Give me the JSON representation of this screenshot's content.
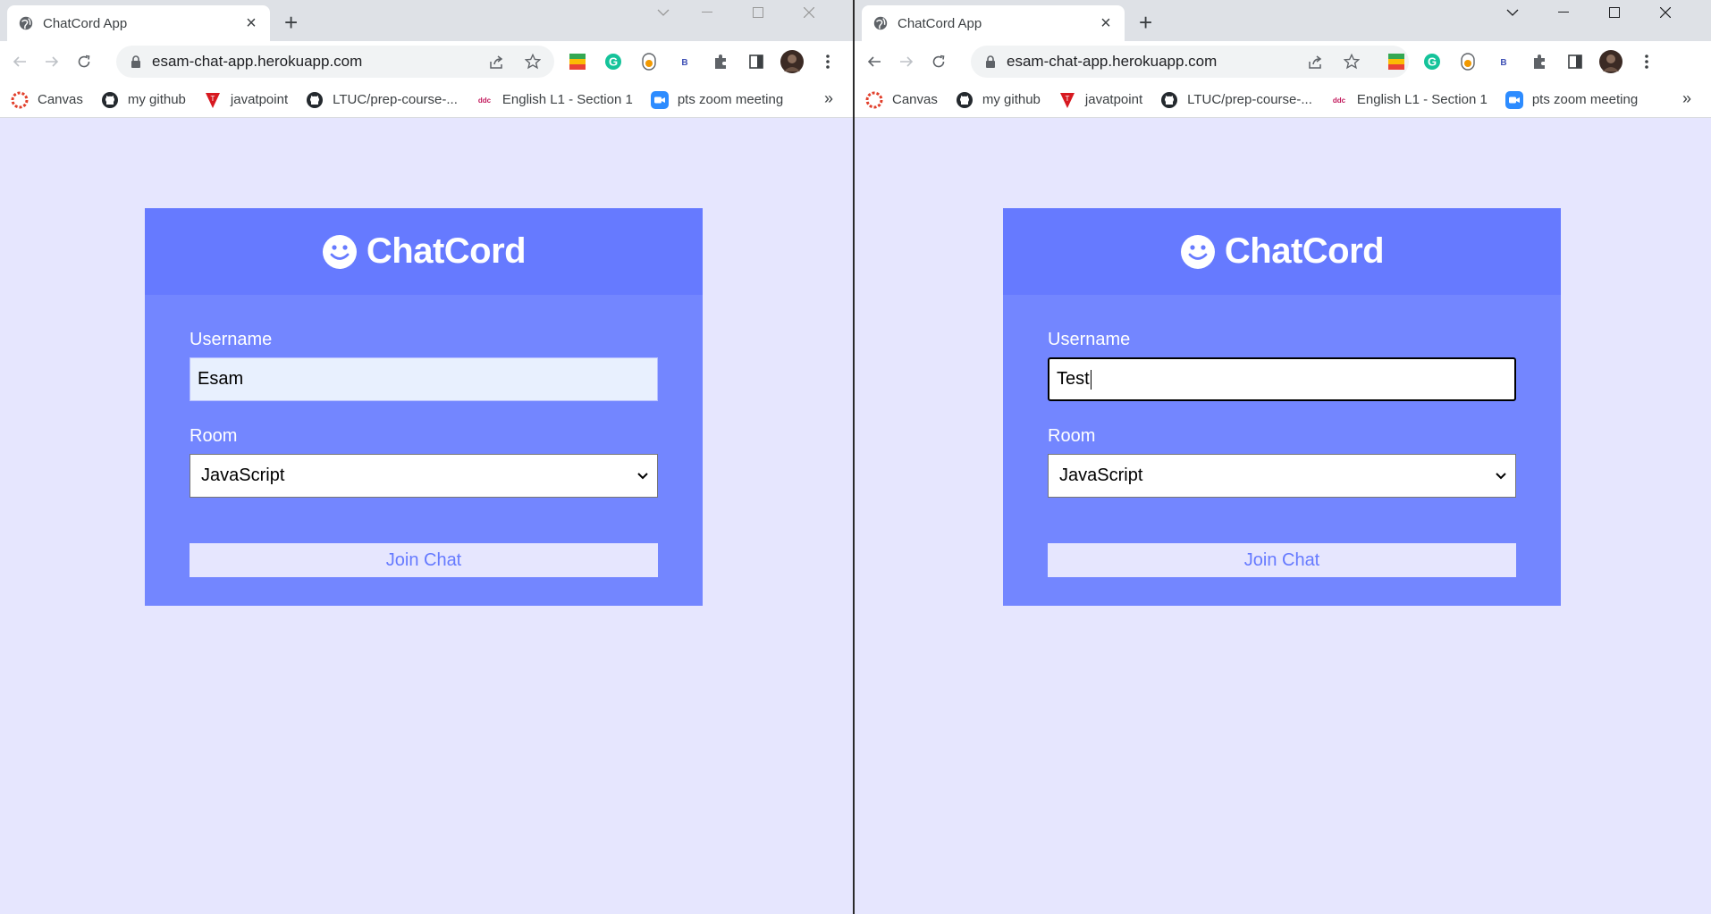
{
  "windows": [
    {
      "tab_title": "ChatCord App",
      "url": "esam-chat-app.herokuapp.com",
      "bookmarks": [
        "Canvas",
        "my github",
        "javatpoint",
        "LTUC/prep-course-...",
        "English L1 - Section 1",
        "pts zoom meeting"
      ],
      "app": {
        "brand": "ChatCord",
        "username_label": "Username",
        "username_value": "Esam",
        "room_label": "Room",
        "room_value": "JavaScript",
        "join_label": "Join Chat"
      }
    },
    {
      "tab_title": "ChatCord App",
      "url": "esam-chat-app.herokuapp.com",
      "bookmarks": [
        "Canvas",
        "my github",
        "javatpoint",
        "LTUC/prep-course-...",
        "English L1 - Section 1",
        "pts zoom meeting"
      ],
      "app": {
        "brand": "ChatCord",
        "username_label": "Username",
        "username_value": "Test",
        "room_label": "Room",
        "room_value": "JavaScript",
        "join_label": "Join Chat"
      }
    }
  ],
  "colors": {
    "page_bg": "#e6e6fe",
    "card_header": "#667aff",
    "card_body": "#7386ff",
    "button_bg": "#e6e6fe",
    "button_text": "#667aff"
  },
  "icons": {
    "tab_favicon": "globe-icon",
    "brand_logo": "smiley-icon",
    "bookmark_icons": [
      "canvas-icon",
      "github-icon",
      "javatpoint-icon",
      "github-icon",
      "ddc-icon",
      "zoom-icon"
    ]
  }
}
